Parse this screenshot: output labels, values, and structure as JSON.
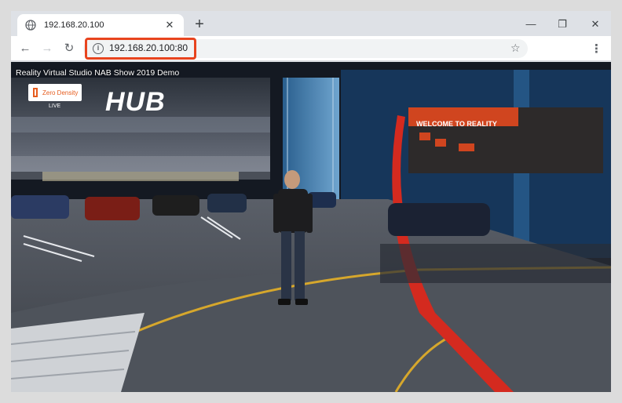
{
  "tab": {
    "title": "192.168.20.100",
    "close_glyph": "✕"
  },
  "new_tab_glyph": "+",
  "window_controls": {
    "minimize": "—",
    "maximize": "❐",
    "close": "✕"
  },
  "toolbar": {
    "back_glyph": "←",
    "forward_glyph": "→",
    "reload_glyph": "↻",
    "url": "192.168.20.100:80",
    "info_glyph": "i",
    "star_glyph": "☆",
    "menu_glyph": "⋮"
  },
  "video": {
    "title": "Reality Virtual Studio NAB Show 2019 Demo",
    "brand": "Zero Density",
    "live_label": "LIVE",
    "sign_text": "HUB",
    "welcome_text": "WELCOME TO REALITY"
  },
  "colors": {
    "highlight": "#e8441e",
    "chrome_bg": "#dee1e6"
  }
}
